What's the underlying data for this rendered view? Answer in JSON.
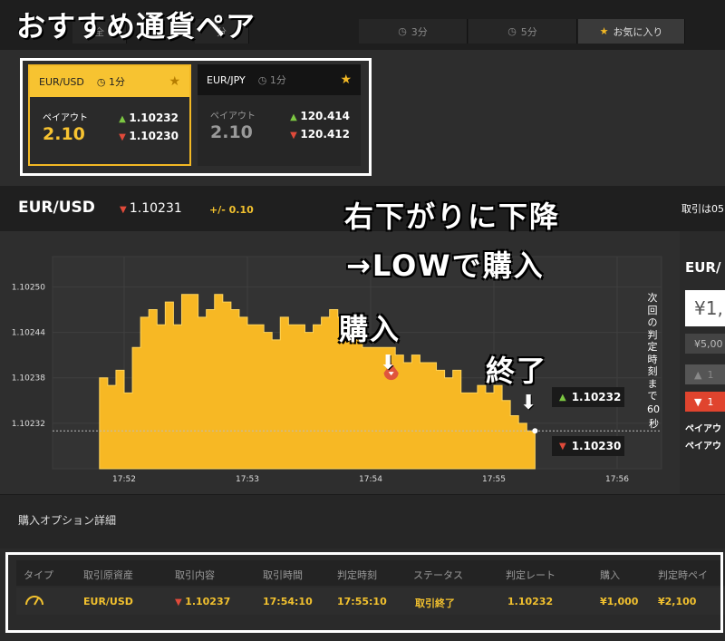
{
  "overlay": {
    "title": "おすすめ通貨ペア",
    "trend_note_line1": "右下がりに下降",
    "trend_note_line2": "→LOWで購入",
    "purchase_note": "購入",
    "end_note": "終了"
  },
  "tabs": [
    {
      "label": "3分",
      "icon": "clock-icon"
    },
    {
      "label": "5分",
      "icon": "clock-icon"
    },
    {
      "label": "お気に入り",
      "icon": "star-icon"
    }
  ],
  "tab_partial_left": "全",
  "tab_partial_mid": "分",
  "pairs": [
    {
      "name": "EUR/USD",
      "duration": "1分",
      "payout_label": "ペイアウト",
      "payout": "2.10",
      "high_rate": "1.10232",
      "low_rate": "1.10230"
    },
    {
      "name": "EUR/JPY",
      "duration": "1分",
      "payout_label": "ペイアウト",
      "payout": "2.10",
      "high_rate": "120.414",
      "low_rate": "120.412"
    }
  ],
  "header": {
    "pair": "EUR/USD",
    "rate": "1.10231",
    "change": "+/- 0.10",
    "trade_label": "取引は05"
  },
  "chart": {
    "y_ticks": [
      "1.10250",
      "1.10244",
      "1.10238",
      "1.10232"
    ],
    "x_ticks": [
      "17:52",
      "17:53",
      "17:54",
      "17:55",
      "17:56"
    ],
    "countdown_text": "次回の判定時刻まで",
    "countdown_value": "60",
    "countdown_unit": "秒",
    "high_label": "1.10232",
    "low_label": "1.10230",
    "accent": "#f7b824"
  },
  "chart_data": {
    "type": "area",
    "ylim": [
      1.10226,
      1.10254
    ],
    "x": [
      "17:51:48",
      "17:51:52",
      "17:51:56",
      "17:52:00",
      "17:52:04",
      "17:52:08",
      "17:52:12",
      "17:52:16",
      "17:52:20",
      "17:52:24",
      "17:52:28",
      "17:52:32",
      "17:52:36",
      "17:52:40",
      "17:52:44",
      "17:52:48",
      "17:52:52",
      "17:52:56",
      "17:53:00",
      "17:53:04",
      "17:53:08",
      "17:53:12",
      "17:53:16",
      "17:53:20",
      "17:53:24",
      "17:53:28",
      "17:53:32",
      "17:53:36",
      "17:53:40",
      "17:53:44",
      "17:53:48",
      "17:53:52",
      "17:53:56",
      "17:54:00",
      "17:54:04",
      "17:54:08",
      "17:54:12",
      "17:54:16",
      "17:54:20",
      "17:54:24",
      "17:54:28",
      "17:54:32",
      "17:54:36",
      "17:54:40",
      "17:54:44",
      "17:54:48",
      "17:54:52",
      "17:54:56",
      "17:55:00",
      "17:55:04",
      "17:55:08",
      "17:55:12",
      "17:55:16",
      "17:55:20"
    ],
    "values": [
      1.10238,
      1.10237,
      1.10239,
      1.10236,
      1.10242,
      1.10246,
      1.10247,
      1.10245,
      1.10248,
      1.10245,
      1.10249,
      1.10249,
      1.10246,
      1.10247,
      1.10249,
      1.10248,
      1.10247,
      1.10246,
      1.10245,
      1.10245,
      1.10244,
      1.10243,
      1.10246,
      1.10245,
      1.10245,
      1.10244,
      1.10245,
      1.10246,
      1.10247,
      1.10246,
      1.10244,
      1.10243,
      1.10242,
      1.10242,
      1.10242,
      1.10242,
      1.10241,
      1.1024,
      1.10241,
      1.1024,
      1.1024,
      1.10239,
      1.10238,
      1.10239,
      1.10236,
      1.10236,
      1.10237,
      1.10236,
      1.10237,
      1.10235,
      1.10233,
      1.10232,
      1.10231,
      1.10231
    ]
  },
  "right_panel": {
    "pair": "EUR/",
    "amount_prefix": "¥1,",
    "preset": "¥5,00",
    "high_btn": "1",
    "low_btn": "1",
    "payout_label1": "ペイアウ",
    "payout_label2": "ペイアウ"
  },
  "option_detail": {
    "title": "購入オプション詳細"
  },
  "table": {
    "headers": [
      "タイプ",
      "取引原資産",
      "取引内容",
      "取引時間",
      "判定時刻",
      "ステータス",
      "判定レート",
      "購入",
      "判定時ペイ"
    ],
    "row": [
      "",
      "EUR/USD",
      "1.10237",
      "17:54:10",
      "17:55:10",
      "取引終了",
      "1.10232",
      "¥1,000",
      "¥2,100"
    ]
  }
}
